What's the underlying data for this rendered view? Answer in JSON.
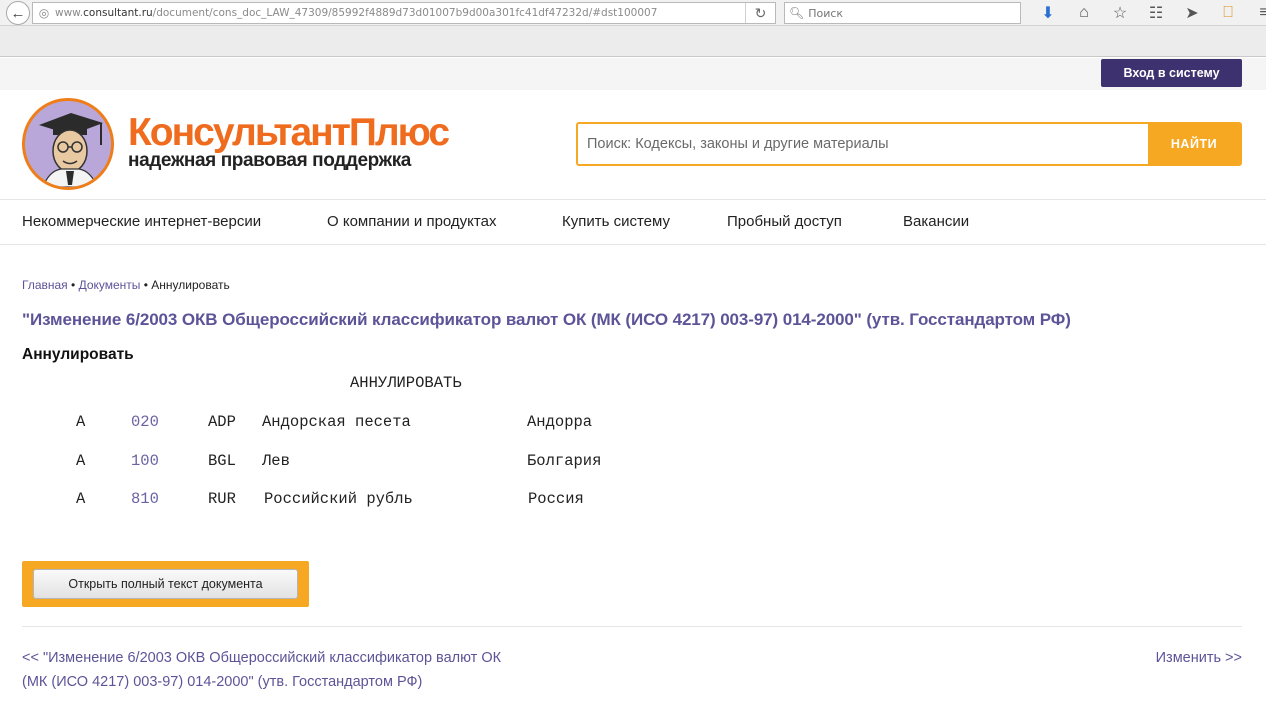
{
  "browser": {
    "url_prefix": "www.",
    "url_domain": "consultant.ru",
    "url_path": "/document/cons_doc_LAW_47309/85992f4889d73d01007b9d00a301fc41df47232d/#dst100007",
    "search_placeholder": "Поиск"
  },
  "header": {
    "login_label": "Вход в систему",
    "logo_main": "КонсультантПлюс",
    "logo_sub": "надежная правовая поддержка",
    "search_placeholder": "Поиск: Кодексы, законы и другие материалы",
    "search_button": "НАЙТИ"
  },
  "nav": [
    "Некоммерческие интернет-версии",
    "О компании и продуктах",
    "Купить систему",
    "Пробный доступ",
    "Вакансии"
  ],
  "breadcrumb": {
    "home": "Главная",
    "sep1": " • ",
    "docs": "Документы",
    "sep2": " • ",
    "current": "Аннулировать"
  },
  "document": {
    "title": "\"Изменение 6/2003 ОКВ Общероссийский классификатор валют ОК (МК (ИСО 4217) 003-97) 014-2000\" (утв. Госстандартом РФ)",
    "section_heading": "Аннулировать",
    "table_heading": "АННУЛИРОВАТЬ",
    "rows": [
      {
        "mark": "А",
        "code": "020",
        "alpha": "ADP",
        "name": "Андорская песета",
        "country": "Андорра"
      },
      {
        "mark": "А",
        "code": "100",
        "alpha": "BGL",
        "name": "Лев",
        "country": "Болгария"
      },
      {
        "mark": "А",
        "code": "810",
        "alpha": "RUR",
        "name": "Российский рубль",
        "country": "Россия"
      }
    ],
    "open_button": "Открыть полный текст документа"
  },
  "pager": {
    "prev_line1": "<< \"Изменение 6/2003 ОКВ Общероссийский классификатор валют ОК",
    "prev_line2": "(МК (ИСО 4217) 003-97) 014-2000\" (утв. Госстандартом РФ)",
    "next": "Изменить >>"
  },
  "colors": {
    "accent_orange": "#f7a823",
    "brand_purple": "#3d3170",
    "link_purple": "#5d5498"
  }
}
